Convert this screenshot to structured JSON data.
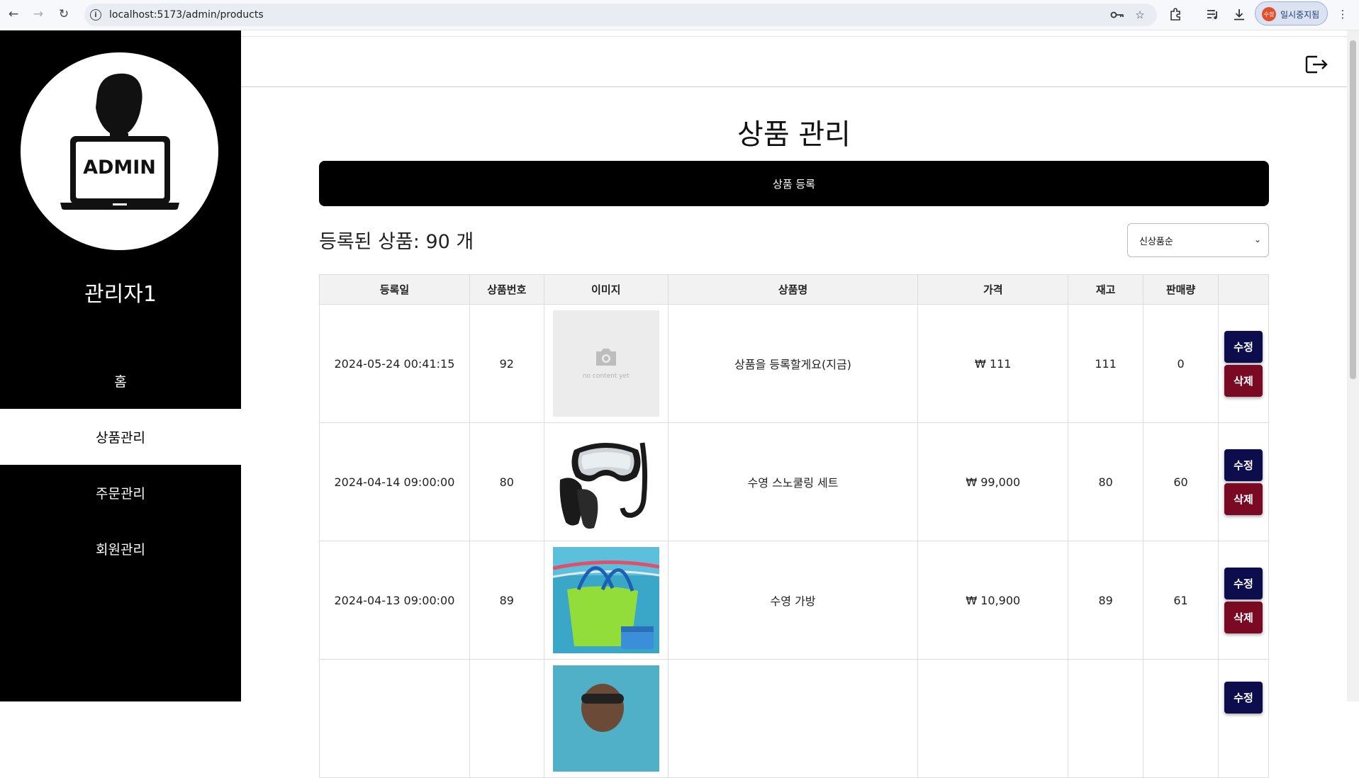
{
  "browser": {
    "url": "localhost:5173/admin/products",
    "profile_label": "일시중지됨",
    "profile_avatar": "수정"
  },
  "sidebar": {
    "logo_text": "ADMIN",
    "admin_name": "관리자1",
    "items": [
      {
        "label": "홈",
        "active": false
      },
      {
        "label": "상품관리",
        "active": true
      },
      {
        "label": "주문관리",
        "active": false
      },
      {
        "label": "회원관리",
        "active": false
      }
    ]
  },
  "main": {
    "page_title": "상품 관리",
    "register_button": "상품 등록",
    "count_text": "등록된 상품: 90 개",
    "sort": {
      "selected": "신상품순"
    },
    "table": {
      "headers": [
        "등록일",
        "상품번호",
        "이미지",
        "상품명",
        "가격",
        "재고",
        "판매량",
        ""
      ],
      "edit_label": "수정",
      "delete_label": "삭제",
      "placeholder_text": "no content yet",
      "rows": [
        {
          "date": "2024-05-24 00:41:15",
          "id": "92",
          "image": "placeholder-camera",
          "name": "상품을 등록할게요(지금)",
          "price": "₩ 111",
          "stock": "111",
          "sales": "0"
        },
        {
          "date": "2024-04-14 09:00:00",
          "id": "80",
          "image": "snorkel-set",
          "name": "수영 스노쿨링 세트",
          "price": "₩ 99,000",
          "stock": "80",
          "sales": "60"
        },
        {
          "date": "2024-04-13 09:00:00",
          "id": "89",
          "image": "mesh-bag",
          "name": "수영 가방",
          "price": "₩ 10,900",
          "stock": "89",
          "sales": "61"
        },
        {
          "date": "",
          "id": "",
          "image": "swimmer-photo",
          "name": "",
          "price": "",
          "stock": "",
          "sales": ""
        }
      ]
    }
  }
}
